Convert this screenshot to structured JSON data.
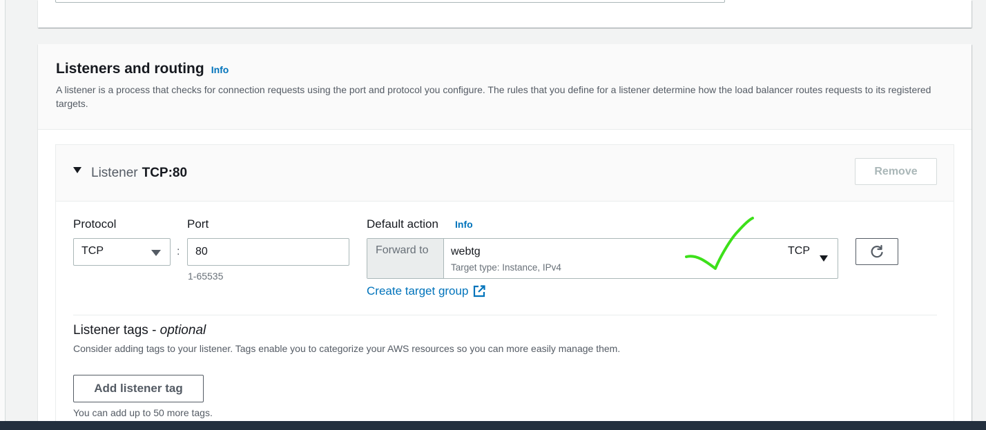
{
  "section": {
    "title": "Listeners and routing",
    "info_label": "Info",
    "description": "A listener is a process that checks for connection requests using the port and protocol you configure. The rules that you define for a listener determine how the load balancer routes requests to its registered targets."
  },
  "listener": {
    "prefix": "Listener",
    "name": "TCP:80",
    "remove_label": "Remove",
    "protocol": {
      "label": "Protocol",
      "value": "TCP"
    },
    "port": {
      "label": "Port",
      "value": "80",
      "hint": "1-65535"
    },
    "default_action": {
      "label": "Default action",
      "info_label": "Info",
      "prefix": "Forward to",
      "target_group": "webtg",
      "target_type": "Target type: Instance, IPv4",
      "target_protocol": "TCP",
      "create_link": "Create target group"
    },
    "tags": {
      "title": "Listener tags - ",
      "title_optional": "optional",
      "description": "Consider adding tags to your listener. Tags enable you to categorize your AWS resources so you can more easily manage them.",
      "add_label": "Add listener tag",
      "hint": "You can add up to 50 more tags."
    }
  },
  "colors": {
    "accent": "#0073bb",
    "annotation": "#3de01a",
    "footer": "#232f3e"
  },
  "icons": [
    "caret-down-icon",
    "dropdown-arrow-icon",
    "refresh-icon",
    "external-link-icon",
    "checkmark-annotation-icon"
  ]
}
